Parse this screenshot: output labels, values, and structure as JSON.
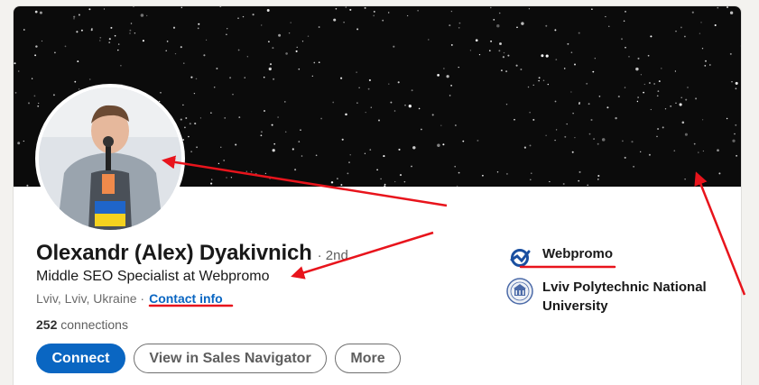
{
  "profile": {
    "name": "Olexandr (Alex) Dyakivnich",
    "degree": "· 2nd",
    "headline": "Middle SEO Specialist at Webpromo",
    "location": "Lviv, Lviv, Ukraine ·",
    "contact_link": "Contact info",
    "connections_count": "252",
    "connections_label": "connections"
  },
  "actions": {
    "connect": "Connect",
    "sales_navigator": "View in Sales Navigator",
    "more": "More"
  },
  "experience": {
    "company": "Webpromo",
    "school": "Lviv Polytechnic National University"
  },
  "colors": {
    "accent": "#0a66c2",
    "annotation": "#e8141c",
    "banner": "#0b0b0b"
  },
  "icons": {
    "company_logo": "webpromo-logo-icon",
    "school_logo": "university-crest-icon"
  }
}
